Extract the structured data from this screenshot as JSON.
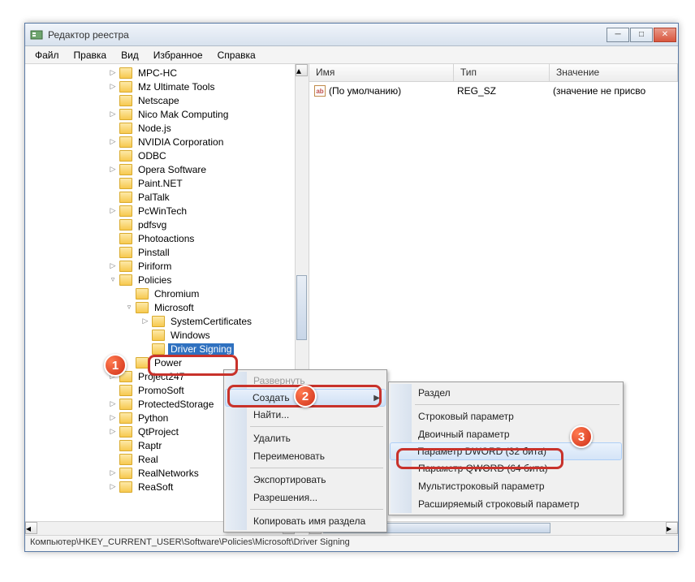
{
  "window": {
    "title": "Редактор реестра"
  },
  "menu": {
    "file": "Файл",
    "edit": "Правка",
    "view": "Вид",
    "favorites": "Избранное",
    "help": "Справка"
  },
  "tree": {
    "items": [
      {
        "indent": 102,
        "toggle": "▷",
        "label": "MPC-HC"
      },
      {
        "indent": 102,
        "toggle": "▷",
        "label": "Mz Ultimate Tools"
      },
      {
        "indent": 102,
        "toggle": "",
        "label": "Netscape"
      },
      {
        "indent": 102,
        "toggle": "▷",
        "label": "Nico Mak Computing"
      },
      {
        "indent": 102,
        "toggle": "",
        "label": "Node.js"
      },
      {
        "indent": 102,
        "toggle": "▷",
        "label": "NVIDIA Corporation"
      },
      {
        "indent": 102,
        "toggle": "",
        "label": "ODBC"
      },
      {
        "indent": 102,
        "toggle": "▷",
        "label": "Opera Software"
      },
      {
        "indent": 102,
        "toggle": "",
        "label": "Paint.NET"
      },
      {
        "indent": 102,
        "toggle": "",
        "label": "PalTalk"
      },
      {
        "indent": 102,
        "toggle": "▷",
        "label": "PcWinTech"
      },
      {
        "indent": 102,
        "toggle": "",
        "label": "pdfsvg"
      },
      {
        "indent": 102,
        "toggle": "",
        "label": "Photoactions"
      },
      {
        "indent": 102,
        "toggle": "",
        "label": "Pinstall"
      },
      {
        "indent": 102,
        "toggle": "▷",
        "label": "Piriform"
      },
      {
        "indent": 102,
        "toggle": "▿",
        "label": "Policies"
      },
      {
        "indent": 122,
        "toggle": "",
        "label": "Chromium"
      },
      {
        "indent": 122,
        "toggle": "▿",
        "label": "Microsoft"
      },
      {
        "indent": 142,
        "toggle": "▷",
        "label": "SystemCertificates"
      },
      {
        "indent": 142,
        "toggle": "",
        "label": "Windows"
      },
      {
        "indent": 142,
        "toggle": "",
        "label": "Driver Signing",
        "selected": true
      },
      {
        "indent": 122,
        "toggle": "",
        "label": "Power"
      },
      {
        "indent": 102,
        "toggle": "▷",
        "label": "Project247"
      },
      {
        "indent": 102,
        "toggle": "",
        "label": "PromoSoft"
      },
      {
        "indent": 102,
        "toggle": "▷",
        "label": "ProtectedStorage"
      },
      {
        "indent": 102,
        "toggle": "▷",
        "label": "Python"
      },
      {
        "indent": 102,
        "toggle": "▷",
        "label": "QtProject"
      },
      {
        "indent": 102,
        "toggle": "",
        "label": "Raptr"
      },
      {
        "indent": 102,
        "toggle": "",
        "label": "Real"
      },
      {
        "indent": 102,
        "toggle": "▷",
        "label": "RealNetworks"
      },
      {
        "indent": 102,
        "toggle": "▷",
        "label": "ReaSoft"
      }
    ]
  },
  "columns": {
    "name": "Имя",
    "type": "Тип",
    "value": "Значение"
  },
  "values": [
    {
      "name": "(По умолчанию)",
      "type": "REG_SZ",
      "value": "(значение не присво"
    }
  ],
  "statusbar": "Компьютер\\HKEY_CURRENT_USER\\Software\\Policies\\Microsoft\\Driver Signing",
  "ctx1": {
    "expand": "Развернуть",
    "create": "Создать",
    "find": "Найти...",
    "delete": "Удалить",
    "rename": "Переименовать",
    "export": "Экспортировать",
    "permissions": "Разрешения...",
    "copyname": "Копировать имя раздела"
  },
  "ctx2": {
    "key": "Раздел",
    "string": "Строковый параметр",
    "binary": "Двоичный параметр",
    "dword": "Параметр DWORD (32 бита)",
    "qword": "Параметр QWORD (64 бита)",
    "multi": "Мультистроковый параметр",
    "expand": "Расширяемый строковый параметр"
  },
  "badges": {
    "b1": "1",
    "b2": "2",
    "b3": "3"
  }
}
